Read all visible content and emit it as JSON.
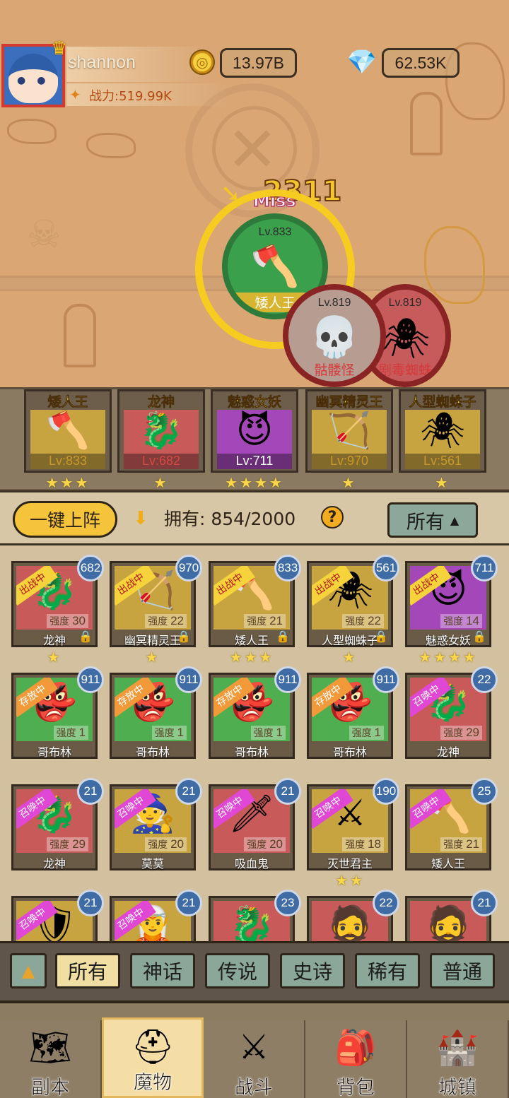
{
  "player": {
    "name": "shannon",
    "power": "战力:519.99K",
    "gold": "13.97B",
    "gems": "62.53K"
  },
  "battle": {
    "damage": "2311",
    "miss": "Miss",
    "units": [
      {
        "level": "Lv.833",
        "name": "矮人王",
        "side": "ally"
      },
      {
        "level": "Lv.819",
        "name": "骷髅怪",
        "side": "enemy"
      },
      {
        "level": "Lv.819",
        "name": "剧毒蜘蛛",
        "side": "enemy"
      }
    ]
  },
  "team": [
    {
      "title": "矮人王",
      "level": "Lv:833",
      "stars": "★★★",
      "bg": "#c8a441",
      "levelColor": "#c89a2a",
      "icon": "dwarf-king-icon",
      "glyph": "🪓"
    },
    {
      "title": "龙神",
      "level": "Lv:682",
      "stars": "★",
      "bg": "#c85a5a",
      "levelColor": "#d44b40",
      "icon": "dragon-icon",
      "glyph": "🐉"
    },
    {
      "title": "魅惑女妖",
      "level": "Lv:711",
      "stars": "★★★★",
      "bg": "#a447b8",
      "levelColor": "#ffffff",
      "icon": "succubus-icon",
      "glyph": "😈"
    },
    {
      "title": "幽冥精灵王",
      "level": "Lv:970",
      "stars": "★",
      "bg": "#c8a441",
      "levelColor": "#c89a2a",
      "icon": "elf-king-icon",
      "glyph": "🏹"
    },
    {
      "title": "人型蜘蛛子",
      "level": "Lv:561",
      "stars": "★",
      "bg": "#c8a441",
      "levelColor": "#c89a2a",
      "icon": "spider-girl-icon",
      "glyph": "🕷"
    }
  ],
  "toolbar": {
    "deploy_label": "一键上阵",
    "owned": "拥有: 854/2000",
    "help": "?",
    "filter_label": "所有"
  },
  "roster": [
    {
      "name": "龙神",
      "level": "682",
      "power_label": "强度",
      "power": "30",
      "status": "出战中",
      "status_kind": "battle",
      "bg": "#c85a5a",
      "stars": "★",
      "locked": true,
      "glyph": "🐉",
      "icon": "dragon-icon"
    },
    {
      "name": "幽冥精灵王",
      "level": "970",
      "power_label": "强度",
      "power": "22",
      "status": "出战中",
      "status_kind": "battle",
      "bg": "#c8a441",
      "stars": "★",
      "locked": true,
      "glyph": "🏹",
      "icon": "elf-king-icon"
    },
    {
      "name": "矮人王",
      "level": "833",
      "power_label": "强度",
      "power": "21",
      "status": "出战中",
      "status_kind": "battle",
      "bg": "#c8a441",
      "stars": "★★★",
      "locked": true,
      "glyph": "🪓",
      "icon": "dwarf-king-icon"
    },
    {
      "name": "人型蜘蛛子",
      "level": "561",
      "power_label": "强度",
      "power": "22",
      "status": "出战中",
      "status_kind": "battle",
      "bg": "#c8a441",
      "stars": "★",
      "locked": true,
      "glyph": "🕷",
      "icon": "spider-girl-icon"
    },
    {
      "name": "魅惑女妖",
      "level": "711",
      "power_label": "强度",
      "power": "14",
      "status": "出战中",
      "status_kind": "battle",
      "bg": "#a447b8",
      "stars": "★★★★",
      "locked": true,
      "glyph": "😈",
      "icon": "succubus-icon"
    },
    {
      "name": "哥布林",
      "level": "911",
      "power_label": "强度",
      "power": "1",
      "status": "存放中",
      "status_kind": "stored",
      "bg": "#4fae4f",
      "stars": "",
      "locked": false,
      "glyph": "👺",
      "icon": "goblin-icon"
    },
    {
      "name": "哥布林",
      "level": "911",
      "power_label": "强度",
      "power": "1",
      "status": "存放中",
      "status_kind": "stored",
      "bg": "#4fae4f",
      "stars": "",
      "locked": false,
      "glyph": "👺",
      "icon": "goblin-icon"
    },
    {
      "name": "哥布林",
      "level": "911",
      "power_label": "强度",
      "power": "1",
      "status": "存放中",
      "status_kind": "stored",
      "bg": "#4fae4f",
      "stars": "",
      "locked": false,
      "glyph": "👺",
      "icon": "goblin-icon"
    },
    {
      "name": "哥布林",
      "level": "911",
      "power_label": "强度",
      "power": "1",
      "status": "存放中",
      "status_kind": "stored",
      "bg": "#4fae4f",
      "stars": "",
      "locked": false,
      "glyph": "👺",
      "icon": "goblin-icon"
    },
    {
      "name": "龙神",
      "level": "22",
      "power_label": "强度",
      "power": "29",
      "status": "召唤中",
      "status_kind": "summon",
      "bg": "#c85a5a",
      "stars": "",
      "locked": false,
      "glyph": "🐉",
      "icon": "dragon-icon"
    },
    {
      "name": "龙神",
      "level": "21",
      "power_label": "强度",
      "power": "29",
      "status": "召唤中",
      "status_kind": "summon",
      "bg": "#c85a5a",
      "stars": "",
      "locked": false,
      "glyph": "🐉",
      "icon": "dragon-icon"
    },
    {
      "name": "莫莫",
      "level": "21",
      "power_label": "强度",
      "power": "20",
      "status": "召唤中",
      "status_kind": "summon",
      "bg": "#c8a441",
      "stars": "",
      "locked": false,
      "glyph": "🧙",
      "icon": "witch-icon"
    },
    {
      "name": "吸血鬼",
      "level": "21",
      "power_label": "强度",
      "power": "20",
      "status": "召唤中",
      "status_kind": "summon",
      "bg": "#c85a5a",
      "stars": "",
      "locked": false,
      "glyph": "🗡",
      "icon": "vampire-icon"
    },
    {
      "name": "灭世君主",
      "level": "190",
      "power_label": "强度",
      "power": "18",
      "status": "召唤中",
      "status_kind": "summon",
      "bg": "#c8a441",
      "stars": "★★",
      "locked": false,
      "glyph": "⚔",
      "icon": "overlord-icon"
    },
    {
      "name": "矮人王",
      "level": "25",
      "power_label": "强度",
      "power": "21",
      "status": "召唤中",
      "status_kind": "summon",
      "bg": "#c8a441",
      "stars": "",
      "locked": false,
      "glyph": "🪓",
      "icon": "dwarf-king-icon"
    },
    {
      "name": "",
      "level": "21",
      "power_label": "",
      "power": "",
      "status": "召唤中",
      "status_kind": "summon",
      "bg": "#c8a441",
      "stars": "",
      "locked": false,
      "glyph": "🛡",
      "icon": "knight-icon"
    },
    {
      "name": "",
      "level": "21",
      "power_label": "",
      "power": "",
      "status": "召唤中",
      "status_kind": "summon",
      "bg": "#c8a441",
      "stars": "",
      "locked": false,
      "glyph": "🧝",
      "icon": "priestess-icon"
    },
    {
      "name": "",
      "level": "23",
      "power_label": "",
      "power": "",
      "status": "",
      "status_kind": "none",
      "bg": "#c85a5a",
      "stars": "",
      "locked": false,
      "glyph": "🐉",
      "icon": "dragon-icon"
    },
    {
      "name": "",
      "level": "22",
      "power_label": "",
      "power": "",
      "status": "",
      "status_kind": "none",
      "bg": "#c85a5a",
      "stars": "",
      "locked": false,
      "glyph": "🧔",
      "icon": "warrior-icon"
    },
    {
      "name": "",
      "level": "21",
      "power_label": "",
      "power": "",
      "status": "",
      "status_kind": "none",
      "bg": "#c85a5a",
      "stars": "",
      "locked": false,
      "glyph": "🧔",
      "icon": "warrior-icon"
    }
  ],
  "rarity_filters": [
    "所有",
    "神话",
    "传说",
    "史诗",
    "稀有",
    "普通"
  ],
  "rarity_colors": [
    "#f1dea3",
    "#8aa79a",
    "#8aa79a",
    "#8aa79a",
    "#8aa79a",
    "#8aa79a"
  ],
  "nav": [
    {
      "label": "副本",
      "icon": "map-icon",
      "glyph": "🗺"
    },
    {
      "label": "魔物",
      "icon": "helmet-icon",
      "glyph": "⛑",
      "active": true
    },
    {
      "label": "战斗",
      "icon": "crossed-swords-icon",
      "glyph": "⚔"
    },
    {
      "label": "背包",
      "icon": "backpack-icon",
      "glyph": "🎒"
    },
    {
      "label": "城镇",
      "icon": "castle-icon",
      "glyph": "🏰"
    }
  ]
}
